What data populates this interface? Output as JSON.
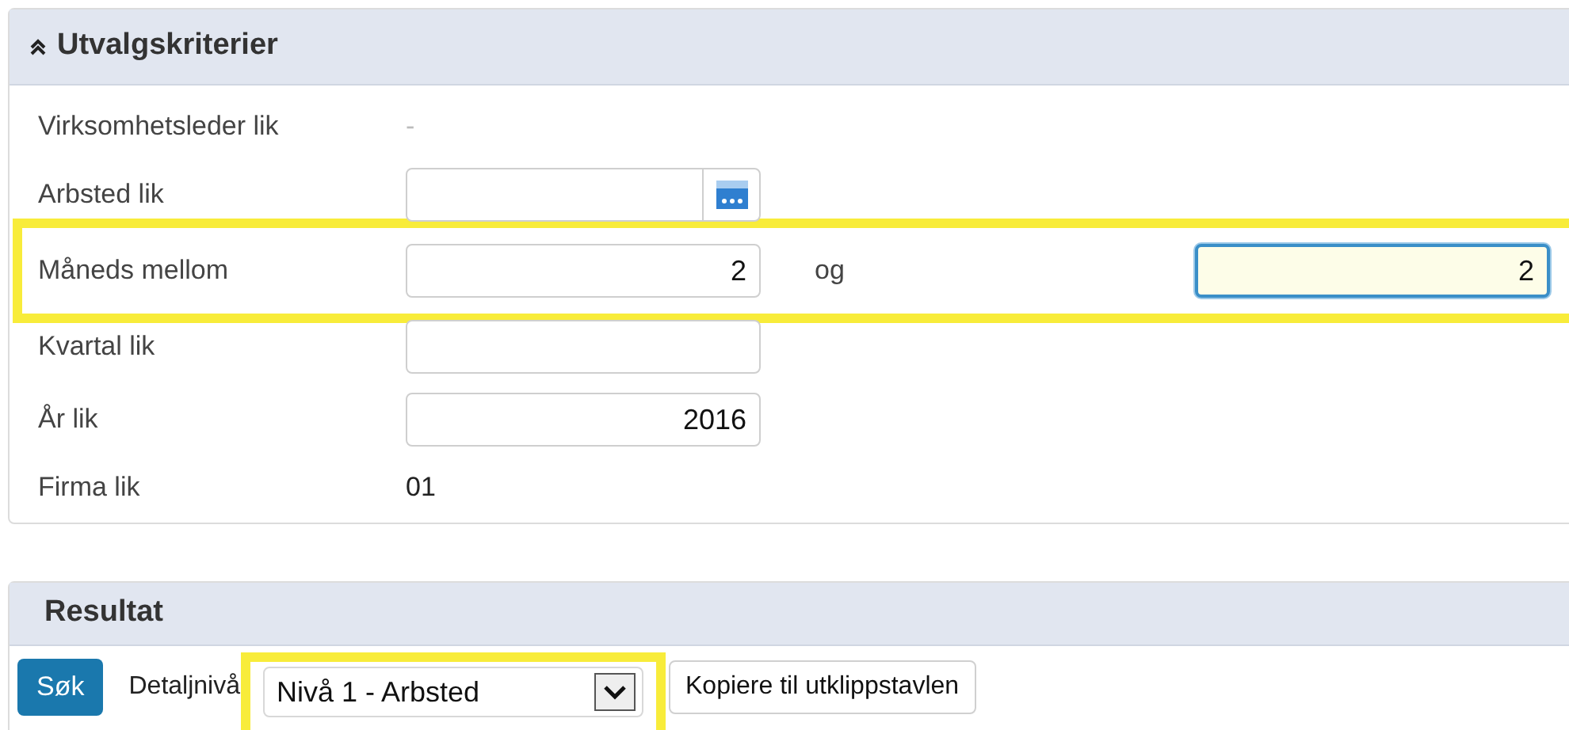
{
  "criteria": {
    "title": "Utvalgskriterier",
    "expanded": true,
    "rows": [
      {
        "kind": "text",
        "label": "Virksomhetsleder lik",
        "value": "-",
        "highlighted": false
      },
      {
        "kind": "lookup",
        "label": "Arbsted lik",
        "value": "",
        "highlighted": false
      },
      {
        "kind": "range",
        "label": "Måneds mellom",
        "value": "2",
        "joiner": "og",
        "value2": "2",
        "focused2": true,
        "highlighted": true
      },
      {
        "kind": "field",
        "label": "Kvartal lik",
        "value": "",
        "highlighted": false
      },
      {
        "kind": "field",
        "label": "År lik",
        "value": "2016",
        "highlighted": false
      },
      {
        "kind": "text",
        "label": "Firma lik",
        "value": "01",
        "highlighted": false
      }
    ]
  },
  "result": {
    "title": "Resultat",
    "search_button": "Søk",
    "detail_label": "Detaljnivå",
    "detail_value": "Nivå 1 - Arbsted",
    "detail_highlighted": true,
    "copy_button": "Kopiere til utklippstavlen"
  }
}
